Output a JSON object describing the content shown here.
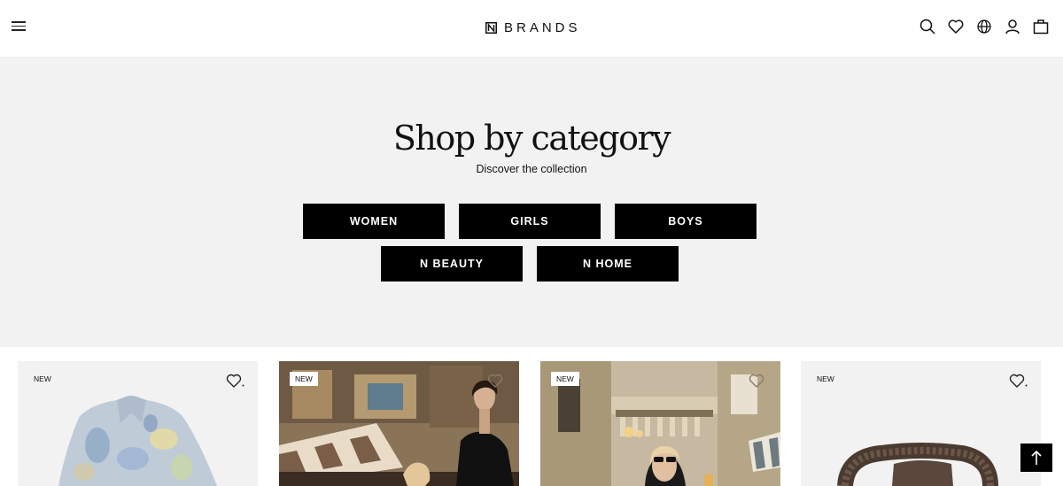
{
  "header": {
    "logo_text": "BRANDS",
    "icons": [
      "menu-icon",
      "search-icon",
      "heart-icon",
      "globe-icon",
      "user-icon",
      "bag-icon"
    ]
  },
  "category": {
    "title": "Shop by category",
    "subtitle": "Discover the collection",
    "buttons": [
      "WOMEN",
      "GIRLS",
      "BOYS",
      "N BEAUTY",
      "N HOME"
    ]
  },
  "products": [
    {
      "badge": "NEW"
    },
    {
      "badge": "NEW"
    },
    {
      "badge": "NEW"
    },
    {
      "badge": "NEW"
    }
  ],
  "colors": {
    "background": "#ffffff",
    "section_bg": "#f2f2f2",
    "button_bg": "#000000",
    "button_text": "#ffffff",
    "text": "#111111"
  }
}
